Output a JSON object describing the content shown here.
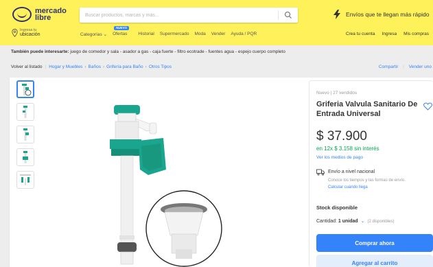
{
  "header": {
    "logo_line1": "mercado",
    "logo_line2": "libre",
    "search_placeholder": "Buscar productos, marcas y más...",
    "promo_text": "Envíos que te llegan más rápido",
    "location_small": "Ingresa tu",
    "location_big": "ubicación",
    "new_badge": "NUEVO",
    "nav": [
      "Categorías ⌄",
      "Ofertas",
      "Historial",
      "Supermercado",
      "Moda",
      "Vender",
      "Ayuda / PQR"
    ],
    "user_nav": [
      "Crea tu cuenta",
      "Ingresa",
      "Mis compras"
    ]
  },
  "suggestions": {
    "label": "También puede interesarte:",
    "items": "juego de comedor y sala - asador a gas - caja fuerte - filtro ecotrade - fuentes agua - espejo cuerpo completo"
  },
  "breadcrumb": {
    "back": "Volver al listado",
    "items": [
      "Hogar y Muebles",
      "Baños",
      "Grifería para Baño",
      "Otros Tipos"
    ],
    "share": "Compartir",
    "sell": "Vender uno"
  },
  "product": {
    "condition": "Nuevo  |  27 vendidos",
    "title": "Griferia Valvula Sanitario De Entrada Universal",
    "price": "$ 37.900",
    "installments": "en 12x $ 3.158 sin interés",
    "payment_link": "Ver los medios de pago",
    "shipping": "Envío a nivel nacional",
    "shipping_sub": "Conoce los tiempos y las formas de envío.",
    "shipping_link": "Calcular cuándo llega",
    "stock": "Stock disponible",
    "qty_label": "Cantidad:",
    "qty_value": "1 unidad",
    "qty_available": "(2 disponibles)",
    "buy_button": "Comprar ahora",
    "cart_button": "Agregar al carrito"
  },
  "colors": {
    "header_bg": "#fff159",
    "accent": "#3483fa",
    "green": "#00a650",
    "teal": "#1aa68e"
  }
}
